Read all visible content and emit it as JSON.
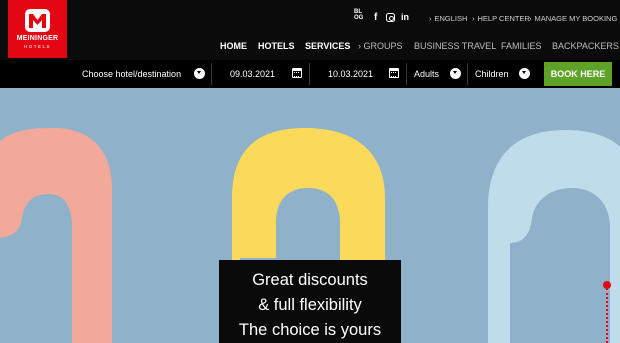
{
  "brand": {
    "name": "MEININGER",
    "sub": "HOTELS",
    "color": "#e30613"
  },
  "social": {
    "blog": "BLOG",
    "facebook": "f",
    "linkedin": "in",
    "instagram_icon": "instagram-icon"
  },
  "utility_nav": [
    {
      "label": "ENGLISH"
    },
    {
      "label": "HELP CENTER"
    },
    {
      "label": "MANAGE MY BOOKING"
    }
  ],
  "main_nav": [
    {
      "label": "HOME"
    },
    {
      "label": "HOTELS"
    },
    {
      "label": "SERVICES"
    }
  ],
  "secondary_nav": [
    {
      "label": "GROUPS"
    },
    {
      "label": "BUSINESS TRAVEL"
    },
    {
      "label": "FAMILIES"
    },
    {
      "label": "BACKPACKERS"
    }
  ],
  "booking": {
    "destination_label": "Choose hotel/destination",
    "checkin": "09.03.2021",
    "checkout": "10.03.2021",
    "adults_label": "Adults",
    "children_label": "Children",
    "book_button": "BOOK HERE",
    "button_color": "#5fa22a"
  },
  "hero": {
    "line1": "Great discounts",
    "line2": "& full flexibility",
    "line3": "The choice is yours",
    "background": "#8fb1c9",
    "hanger_colors": [
      "#f2a99a",
      "#fbd95a",
      "#bfdcea"
    ]
  }
}
